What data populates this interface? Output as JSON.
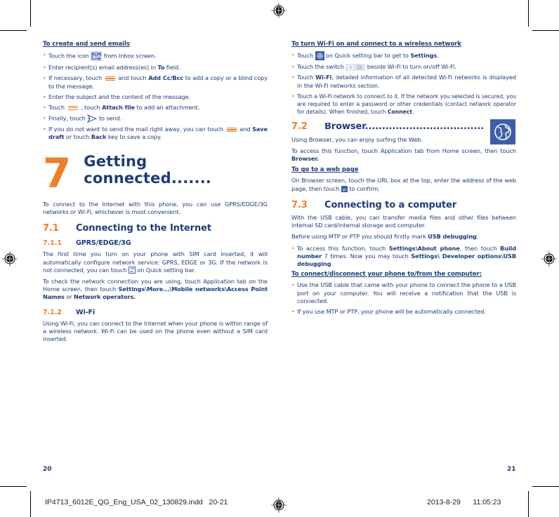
{
  "left_page": {
    "email_section": {
      "heading": "To create and send emails",
      "bullets": [
        {
          "before": "Touch the icon",
          "icon": "compose-mail-icon",
          "after": "from Inbox screen."
        },
        {
          "before": "Enter recipient(s) email address(es) in ",
          "bold": "To",
          "after": " field."
        },
        {
          "before": "If necessary, touch",
          "icon": "menu-icon",
          "middle": "and touch ",
          "bold": "Add Cc/Bcc",
          "after": " to add a copy or a blind copy to the message."
        },
        {
          "before": "Enter the subject and the content of the message."
        },
        {
          "before": "Touch",
          "icon": "menu-icon",
          "middle": ", touch ",
          "bold": "Attach file",
          "after": " to add an attachment."
        },
        {
          "before": "Finally, touch",
          "icon": "send-icon",
          "after": "to send."
        },
        {
          "before": "If you do not want to send the mail right away, you can touch",
          "icon": "menu-icon",
          "middle": "and ",
          "bold": "Save draft",
          "middle2": " or touch ",
          "bold2": "Back",
          "after": " key to save a copy."
        }
      ]
    },
    "chapter": {
      "number": "7",
      "title": "Getting connected......."
    },
    "intro": "To connect to the Internet with this phone, you can use GPRS/EDGE/3G networks or Wi-Fi, whichever is most convenient.",
    "section_7_1": {
      "number": "7.1",
      "title": "Connecting to the Internet"
    },
    "section_7_1_1": {
      "number": "7.1.1",
      "title": "GPRS/EDGE/3G",
      "para1_before": "The first time you turn on your phone with SIM card inserted, it will automatically configure network service: GPRS, EDGE or 3G. If the network is not connected, you can touch",
      "para1_icon": "mobile-data-icon",
      "para1_after": "on Quick setting bar.",
      "para2_before": "To check the network connection you are using, touch Application tab on the Home screen, then touch ",
      "para2_bold1": "Settings\\More...\\Mobile networks\\Access Point Names",
      "para2_middle": " or ",
      "para2_bold2": "Network operators."
    },
    "section_7_1_2": {
      "number": "7.1.2",
      "title": "Wi-Fi",
      "para": "Using Wi-Fi, you can connect to the Internet when your phone is within range of a wireless network. Wi-Fi can be used on the phone even without a SIM card inserted."
    },
    "page_number": "20"
  },
  "right_page": {
    "wifi_section": {
      "heading": "To turn Wi-Fi on and connect to a wireless network",
      "b1_before": "Touch",
      "b1_icon": "settings-gear-icon",
      "b1_middle": "on Quick setting bar to get to ",
      "b1_bold": "Settings",
      "b1_after": ".",
      "b2_before": "Touch the switch",
      "b2_icon": "toggle-switch-icon",
      "b2_after": "beside Wi-Fi to  turn on/off Wi-Fi.",
      "b3_before": "Touch ",
      "b3_bold": "Wi-Fi",
      "b3_after": ", detailed information of all detected Wi-Fi networks is displayed in the Wi-Fi networks section.",
      "b4_before": "Touch a Wi-Fi network to connect to it. If the network you selected is secured, you are required to enter a password or other credentials (contact network operator for details). When finished, touch ",
      "b4_bold": "Connect",
      "b4_after": "."
    },
    "section_7_2": {
      "number": "7.2",
      "title": "Browser...................................",
      "icon": "globe-browser-icon",
      "para1": "Using Browser, you can enjoy surfing the Web.",
      "para2_before": "To access this function, touch Application tab from Home screen, then touch ",
      "para2_bold": "Browser.",
      "subheading": "To go to a web page",
      "para3_before": "On Browser screen, touch the URL box at the top, enter the address of the web page, then touch",
      "para3_icon": "go-icon",
      "para3_after": "to confirm."
    },
    "section_7_3": {
      "number": "7.3",
      "title": "Connecting to a computer",
      "para1": "With the USB cable, you can transfer media files and other files between internal SD card/internal storage and computer.",
      "para2_before": "Before using MTP or PTP you should firstly mark ",
      "para2_bold": "USB debugging",
      "para2_after": ".",
      "bullet1_before": "To access this function, touch ",
      "bullet1_bold1": "Settings\\About phone",
      "bullet1_middle1": ", then touch ",
      "bullet1_bold2": "Build number",
      "bullet1_middle2": " 7 times. Now you may touch ",
      "bullet1_bold3": "Settings\\ Developer options\\USB debugging",
      "bullet1_after": ".",
      "subheading": "To connect/disconnect your phone to/from the computer:",
      "bullet2": "Use the USB cable that came with your phone to connect the phone to a USB port on your computer. You will receive a notification that the USB is connected.",
      "bullet3": "If you use MTP or PTP, your phone will be automatically connected."
    },
    "page_number": "21"
  },
  "slug": {
    "filename": "IP4713_6012E_QG_Eng_USA_02_130829.indd",
    "pages": "20-21",
    "date": "2013-8-29",
    "time": "11:05:23"
  },
  "colors": {
    "text": "#1e3c78",
    "accent": "#f07d2a",
    "icon_blue": "#3e5ea8"
  }
}
